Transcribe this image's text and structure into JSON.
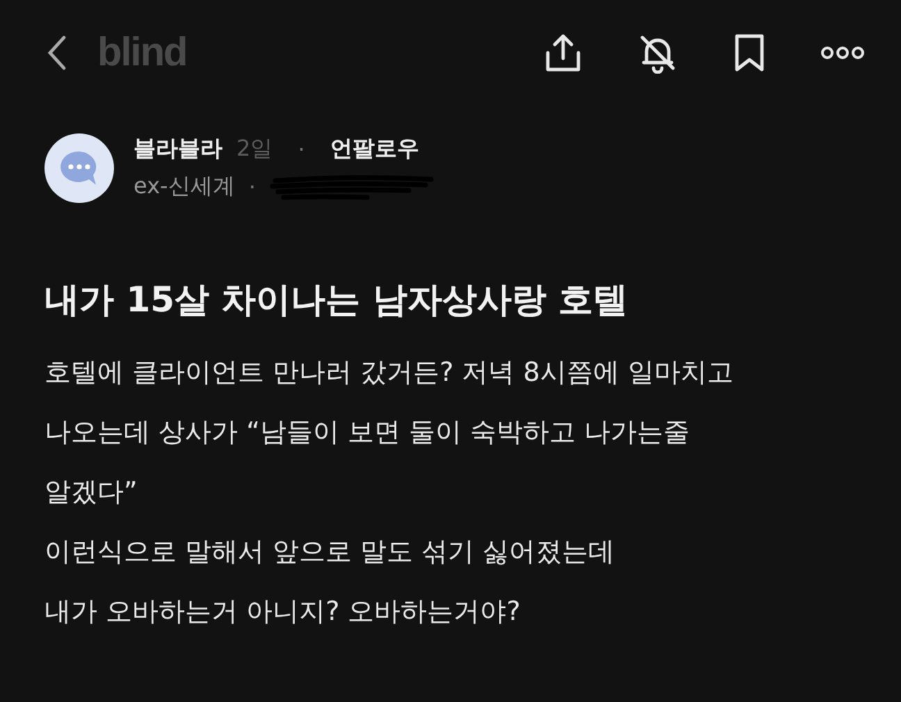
{
  "header": {
    "logo": "blind"
  },
  "author": {
    "name": "블라블라",
    "time": "2일",
    "separator": "·",
    "follow": "언팔로우",
    "company": "ex-신세계",
    "company_separator": "·"
  },
  "post": {
    "title": "내가 15살 차이나는 남자상사랑 호텔",
    "body": [
      "호텔에 클라이언트 만나러 갔거든? 저녁 8시쯤에 일마치고",
      "나오는데 상사가 “남들이 보면 둘이 숙박하고 나가는줄",
      "알겠다”",
      "이런식으로 말해서 앞으로 말도 섞기 싫어졌는데",
      "내가 오바하는거 아니지? 오바하는거야?"
    ]
  }
}
